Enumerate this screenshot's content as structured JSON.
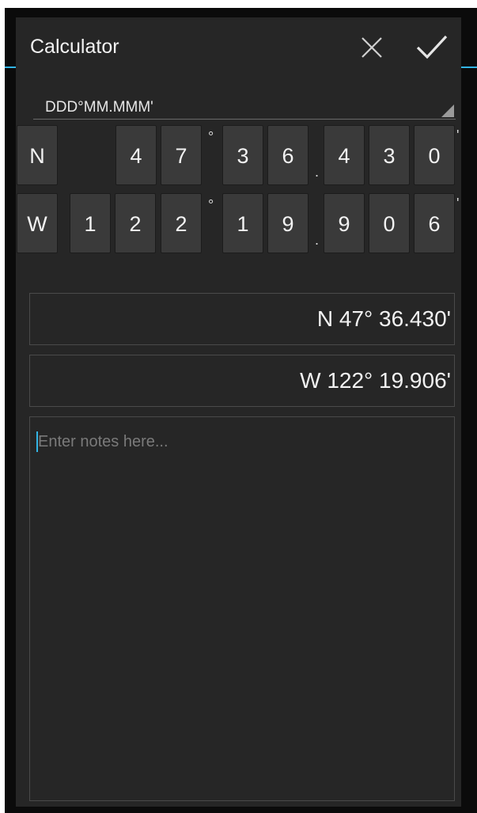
{
  "dialog": {
    "title": "Calculator",
    "close_icon": "close-icon",
    "confirm_icon": "check-icon",
    "accent_color": "#33b5e5"
  },
  "format_select": {
    "value": "DDD°MM.MMM'"
  },
  "coordinates": {
    "latitude": {
      "hemisphere": "N",
      "degrees": [
        "4",
        "7"
      ],
      "minutes": [
        "3",
        "6"
      ],
      "decimals": [
        "4",
        "3",
        "0"
      ]
    },
    "longitude": {
      "hemisphere": "W",
      "degrees": [
        "1",
        "2",
        "2"
      ],
      "minutes": [
        "1",
        "9"
      ],
      "decimals": [
        "9",
        "0",
        "6"
      ]
    },
    "degree_symbol": "°",
    "decimal_point": ".",
    "minute_symbol": "'"
  },
  "readouts": {
    "latitude": "N 47° 36.430'",
    "longitude": "W 122° 19.906'"
  },
  "notes": {
    "value": "",
    "placeholder": "Enter notes here..."
  }
}
